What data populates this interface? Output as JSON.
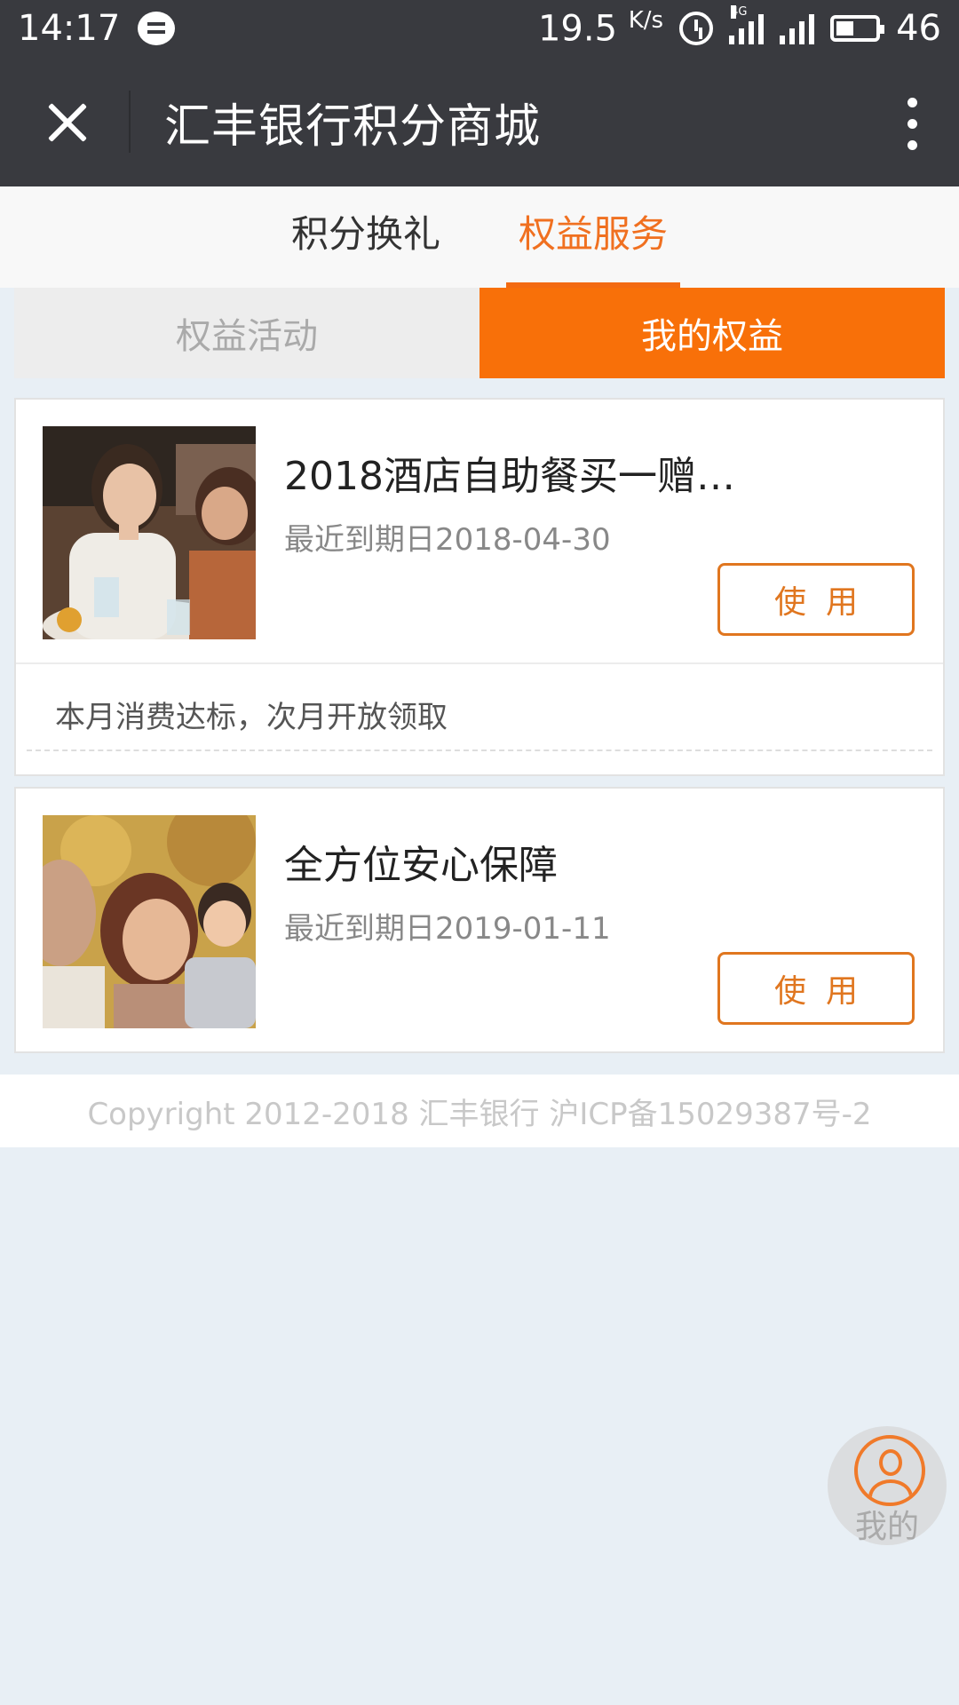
{
  "status_bar": {
    "time": "14:17",
    "speed_value": "19.5",
    "speed_unit": "K/s",
    "network_label": "4G",
    "battery_level": "46",
    "icons": [
      "message-icon",
      "alarm-icon",
      "signal-4g-icon",
      "signal-icon",
      "battery-icon"
    ]
  },
  "title_bar": {
    "title": "汇丰银行积分商城",
    "close_icon": "close-icon",
    "more_icon": "more-vertical-icon"
  },
  "main_tabs": [
    {
      "label": "积分换礼",
      "active": false
    },
    {
      "label": "权益服务",
      "active": true
    }
  ],
  "sub_tabs": [
    {
      "label": "权益活动",
      "active": false
    },
    {
      "label": "我的权益",
      "active": true
    }
  ],
  "cards": [
    {
      "title": "2018酒店自助餐买一赠…",
      "expiry": "最近到期日2018-04-30",
      "button": "使用",
      "note": "本月消费达标，次月开放领取"
    },
    {
      "title": "全方位安心保障",
      "expiry": "最近到期日2019-01-11",
      "button": "使用"
    }
  ],
  "footer": {
    "copyright": "Copyright 2012-2018 汇丰银行 沪ICP备15029387号-2"
  },
  "float_button": {
    "label": "我的",
    "icon": "user-icon"
  },
  "colors": {
    "accent": "#f87009",
    "header_bg": "#393a3f",
    "page_bg": "#e8eff5"
  }
}
